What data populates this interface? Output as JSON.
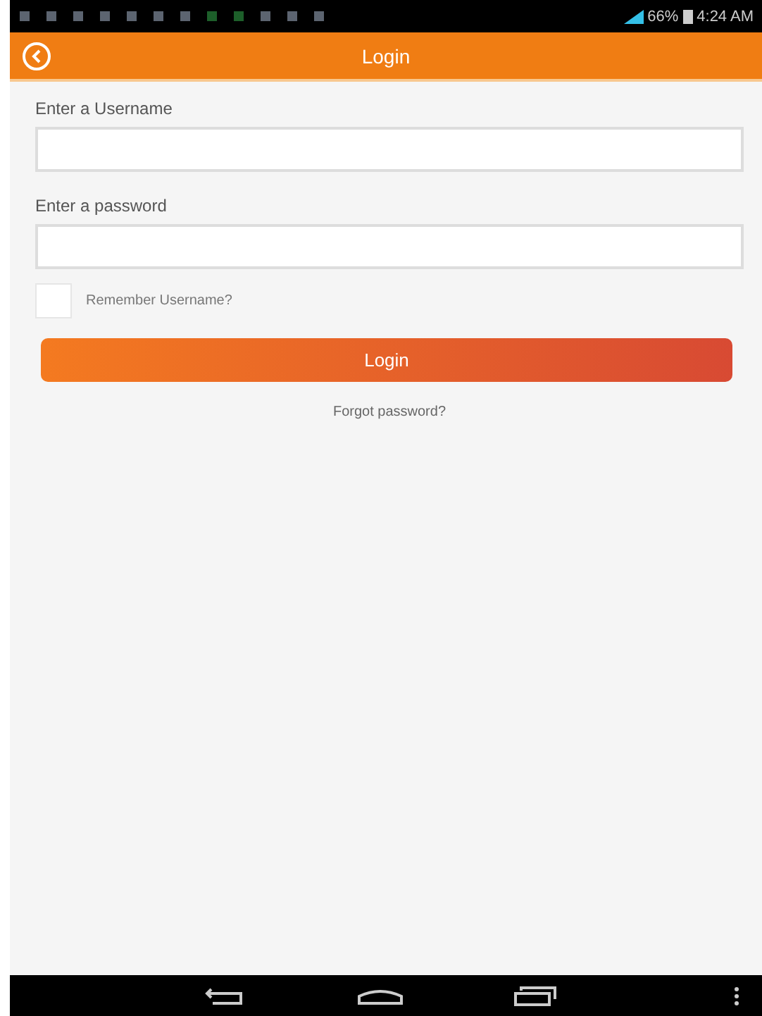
{
  "status_bar": {
    "battery": "66%",
    "time": "4:24 AM"
  },
  "app_bar": {
    "title": "Login"
  },
  "fields": [
    {
      "label": "Enter a Username"
    },
    {
      "label": "Enter a password"
    }
  ],
  "remember": {
    "label": "Remember Username?",
    "checked": false
  },
  "login_button": "Login",
  "forgot_link": "Forgot password?"
}
